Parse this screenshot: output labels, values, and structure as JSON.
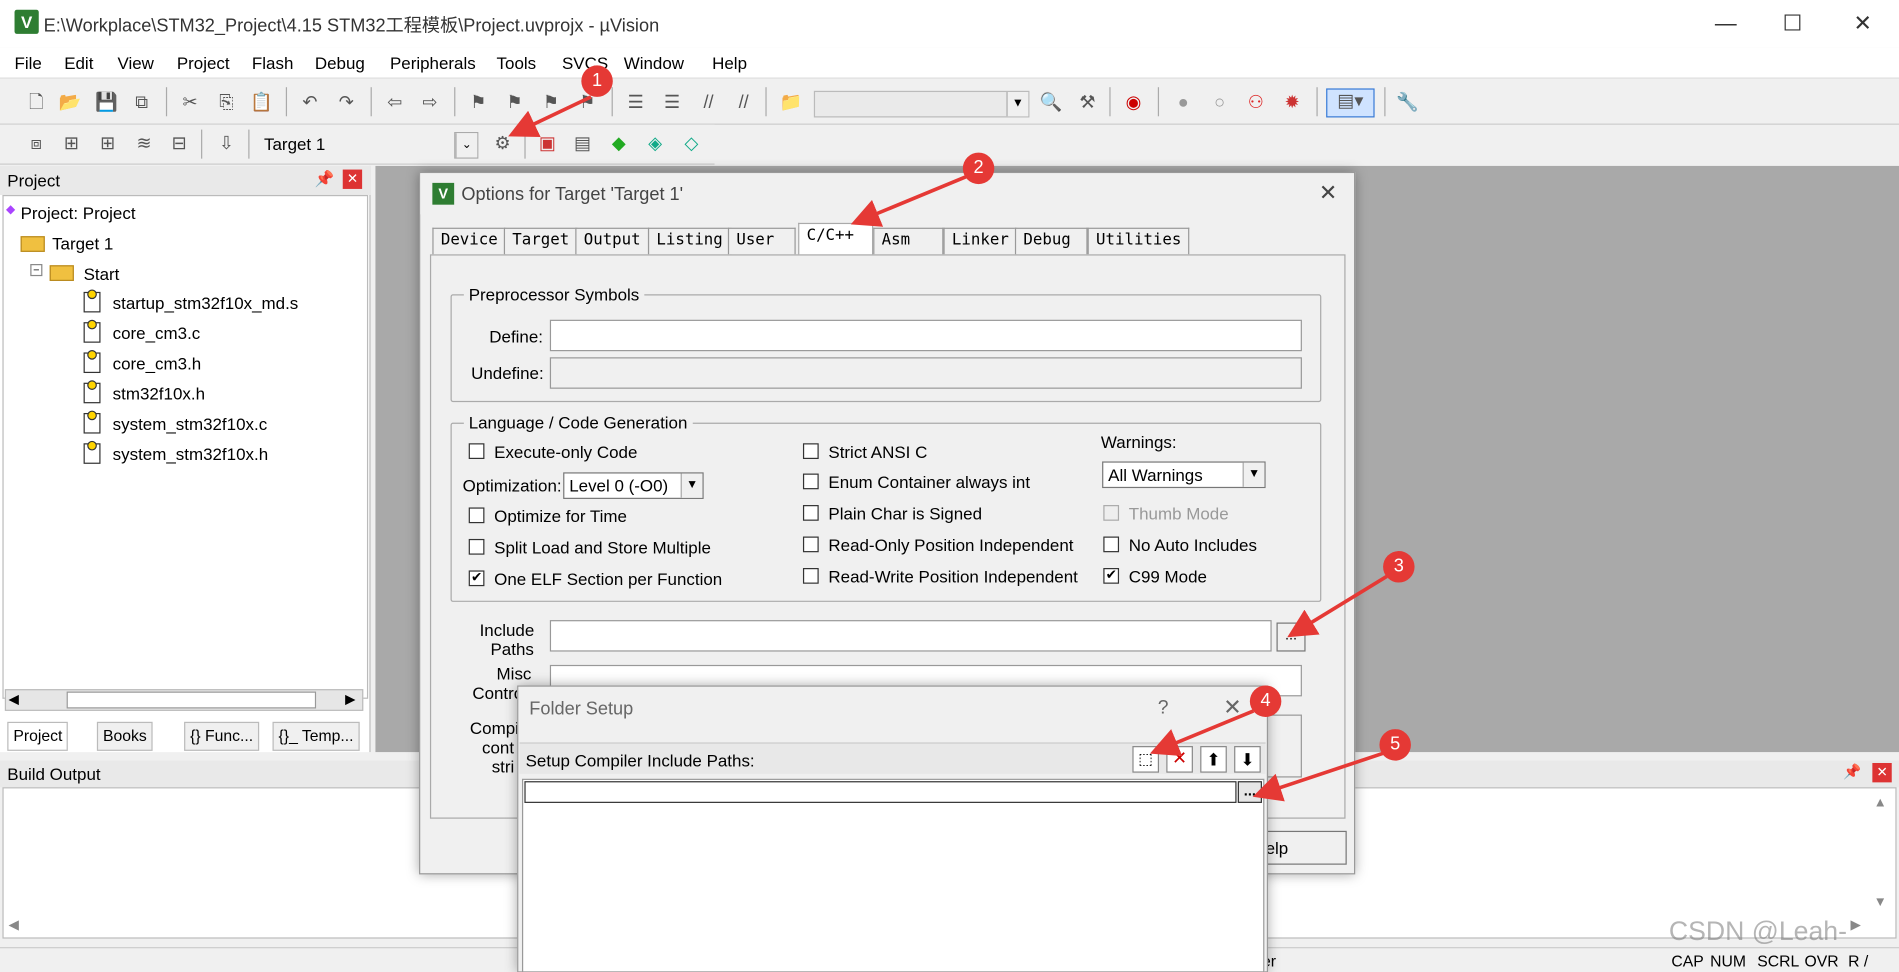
{
  "window": {
    "title": "E:\\Workplace\\STM32_Project\\4.15 STM32工程模板\\Project.uvprojx - µVision"
  },
  "menu": [
    "File",
    "Edit",
    "View",
    "Project",
    "Flash",
    "Debug",
    "Peripherals",
    "Tools",
    "SVCS",
    "Window",
    "Help"
  ],
  "toolbar2": {
    "target": "Target 1"
  },
  "project_panel": {
    "title": "Project",
    "root": "Project: Project",
    "target": "Target 1",
    "group": "Start",
    "files": [
      "startup_stm32f10x_md.s",
      "core_cm3.c",
      "core_cm3.h",
      "stm32f10x.h",
      "system_stm32f10x.c",
      "system_stm32f10x.h"
    ],
    "tabs": [
      "Project",
      "Books",
      "{} Func...",
      "{}_ Temp..."
    ]
  },
  "build_output": {
    "title": "Build Output"
  },
  "options_dialog": {
    "title": "Options for Target 'Target 1'",
    "tabs": [
      "Device",
      "Target",
      "Output",
      "Listing",
      "User",
      "C/C++",
      "Asm",
      "Linker",
      "Debug",
      "Utilities"
    ],
    "active_tab": "C/C++",
    "preprocessor": {
      "legend": "Preprocessor Symbols",
      "define_label": "Define:",
      "undefine_label": "Undefine:"
    },
    "language": {
      "legend": "Language / Code Generation",
      "execute_only": "Execute-only Code",
      "optimization_label": "Optimization:",
      "optimization_value": "Level 0 (-O0)",
      "optimize_time": "Optimize for Time",
      "split_load": "Split Load and Store Multiple",
      "one_elf": "One ELF Section per Function",
      "strict_ansi": "Strict ANSI C",
      "enum_int": "Enum Container always int",
      "plain_char": "Plain Char is Signed",
      "ro_pi": "Read-Only Position Independent",
      "rw_pi": "Read-Write Position Independent",
      "warnings_label": "Warnings:",
      "warnings_value": "All Warnings",
      "thumb_mode": "Thumb Mode",
      "no_auto_includes": "No Auto Includes",
      "c99_mode": "C99 Mode"
    },
    "include_label_1": "Include",
    "include_label_2": "Paths",
    "misc_label_1": "Misc",
    "misc_label_2": "Contro",
    "compile_label_1": "Compil",
    "compile_label_2": "cont",
    "compile_label_3": "stri",
    "help_button": "elp",
    "browse": "..."
  },
  "folder_setup": {
    "title": "Folder Setup",
    "help": "?",
    "label": "Setup Compiler Include Paths:",
    "browse": "..."
  },
  "markers": [
    "1",
    "2",
    "3",
    "4",
    "5"
  ],
  "status": {
    "partial": "er",
    "indicators": [
      "CAP",
      "NUM",
      "SCRL",
      "OVR",
      "R /"
    ]
  },
  "watermark": "CSDN @Leah-",
  "colors": {
    "marker": "#e53935",
    "gray_area": "#a9a9a9"
  }
}
